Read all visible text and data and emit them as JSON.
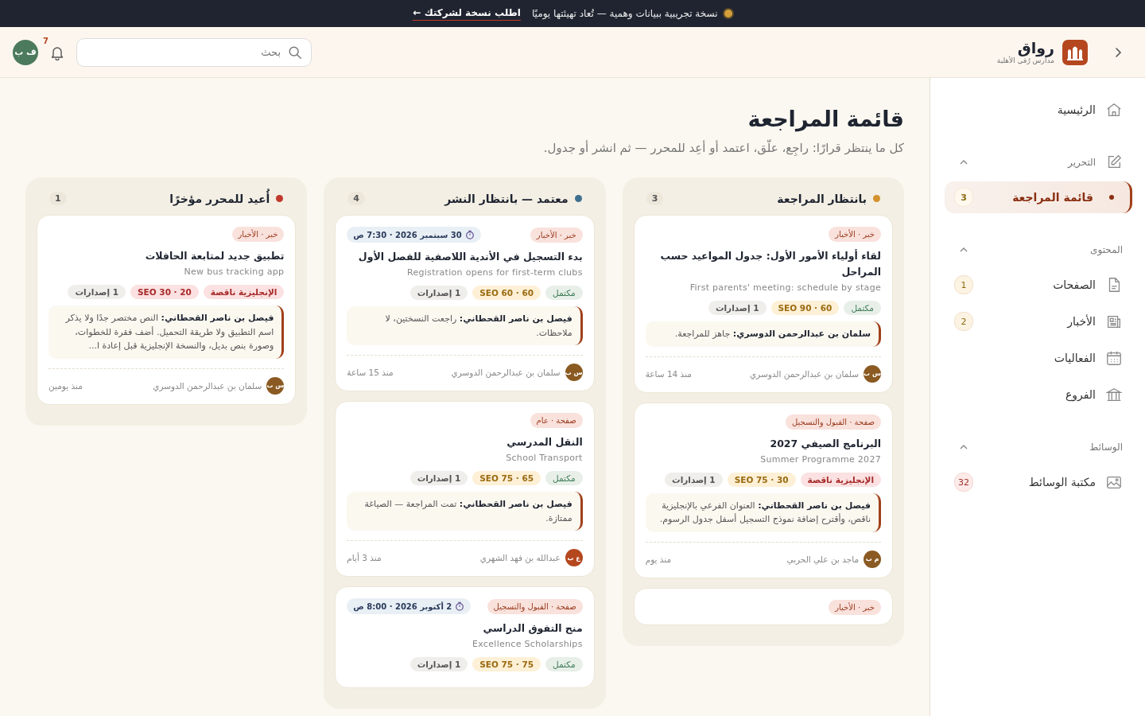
{
  "banner": {
    "text": "نسخة تجريبية ببيانات وهمية — تُعاد تهيئتها يوميًا",
    "link": "اطلب نسخة لشركتك ←"
  },
  "header": {
    "brand": "رواق",
    "org": "مدارس رُقي الأهلية",
    "search": {
      "placeholder": "بحث"
    },
    "notifications": "7",
    "user_initials": "ف ب"
  },
  "sidebar": {
    "items": [
      {
        "kind": "link",
        "label": "الرئيسية",
        "selected": false
      },
      {
        "kind": "section",
        "label": "التحرير",
        "expanded": true,
        "items": [
          {
            "label": "قائمة المراجعة",
            "count": "3",
            "selected": true
          }
        ]
      },
      {
        "kind": "section",
        "label": "المحتوى",
        "expanded": true,
        "items": [
          {
            "label": "الصفحات",
            "count": "1",
            "selected": false
          },
          {
            "label": "الأخبار",
            "count": "2",
            "selected": false
          },
          {
            "label": "الفعاليات",
            "selected": false
          },
          {
            "label": "الفروع",
            "selected": false
          }
        ]
      },
      {
        "kind": "section",
        "label": "الوسائط",
        "expanded": true,
        "items": [
          {
            "label": "مكتبة الوسائط",
            "count": "32",
            "selected": false
          }
        ]
      }
    ]
  },
  "page": {
    "title": "قائمة المراجعة",
    "subtitle": "كل ما ينتظر قرارًا: راجِع، علّق، اعتمد أو أعِد للمحرر — ثم انشر أو جدول."
  },
  "columns": [
    {
      "title": "بانتظار المراجعة",
      "count": "3",
      "color": "#d4912c",
      "cards": [
        {
          "tag": "خبر · الأخبار",
          "title": "لقاء أولياء الأمور الأول: جدول المواعيد حسب المراحل",
          "subtitle": "First parents' meeting: schedule by stage",
          "status": {
            "label": "مكتمل",
            "kind": "complete"
          },
          "seo": {
            "label": "SEO 90 · 60",
            "kind": "ok"
          },
          "versions": "1 إصدارات",
          "note": "**سلمان بن عبدالرحمن الدوسري:** جاهز للمراجعة.",
          "author": {
            "initials": "س ب",
            "name": "سلمان بن عبدالرحمن الدوسري",
            "color": "#8a5a22"
          },
          "time": "منذ 14 ساعة"
        },
        {
          "tag": "صفحة · القبول والتسجيل",
          "title": "البرنامج الصيفي 2027",
          "subtitle": "Summer Programme 2027",
          "status": {
            "label": "الإنجليزية ناقصة",
            "kind": "missing"
          },
          "seo": {
            "label": "SEO 75 · 30",
            "kind": "ok"
          },
          "versions": "1 إصدارات",
          "note": "**فيصل بن ناصر القحطاني:** العنوان الفرعي بالإنجليزية ناقص، وأقترح إضافة نموذج التسجيل أسفل جدول الرسوم.",
          "author": {
            "initials": "م ب",
            "name": "ماجد بن علي الحربي",
            "color": "#8a5a22"
          },
          "time": "منذ يوم"
        },
        {
          "tag": "خبر · الأخبار"
        }
      ]
    },
    {
      "title": "معتمد — بانتظار النشر",
      "count": "4",
      "color": "#3f6f8f",
      "cards": [
        {
          "tag": "خبر · الأخبار",
          "schedule": "30 سبتمبر 2026 · 7:30 ص",
          "title": "بدء التسجيل في الأندية اللاصفية للفصل الأول",
          "subtitle": "Registration opens for first-term clubs",
          "status": {
            "label": "مكتمل",
            "kind": "complete"
          },
          "seo": {
            "label": "SEO 60 · 60",
            "kind": "ok"
          },
          "versions": "1 إصدارات",
          "note": "**فيصل بن ناصر القحطاني:** راجعت النسختين، لا ملاحظات.",
          "author": {
            "initials": "س ب",
            "name": "سلمان بن عبدالرحمن الدوسري",
            "color": "#8a5a22"
          },
          "time": "منذ 15 ساعة"
        },
        {
          "tag": "صفحة · عام",
          "title": "النقل المدرسي",
          "subtitle": "School Transport",
          "status": {
            "label": "مكتمل",
            "kind": "complete"
          },
          "seo": {
            "label": "SEO 75 · 65",
            "kind": "ok"
          },
          "versions": "1 إصدارات",
          "note": "**فيصل بن ناصر القحطاني:** تمت المراجعة — الصياغة ممتازة.",
          "author": {
            "initials": "ع ب",
            "name": "عبدالله بن فهد الشهري",
            "color": "#b5471f"
          },
          "time": "منذ 3 أيام"
        },
        {
          "tag": "صفحة · القبول والتسجيل",
          "schedule": "2 أكتوبر 2026 · 8:00 ص",
          "title": "منح التفوق الدراسي",
          "subtitle": "Excellence Scholarships",
          "status": {
            "label": "مكتمل",
            "kind": "complete"
          },
          "seo": {
            "label": "SEO 75 · 75",
            "kind": "ok"
          },
          "versions": "1 إصدارات"
        }
      ]
    },
    {
      "title": "أُعيد للمحرر مؤخرًا",
      "count": "1",
      "color": "#c0392b",
      "cards": [
        {
          "tag": "خبر · الأخبار",
          "title": "تطبيق جديد لمتابعة الحافلات",
          "subtitle": "New bus tracking app",
          "status": {
            "label": "الإنجليزية ناقصة",
            "kind": "missing"
          },
          "seo": {
            "label": "SEO 30 · 20",
            "kind": "low"
          },
          "versions": "1 إصدارات",
          "note": "**فيصل بن ناصر القحطاني:** النص مختصر جدًا ولا يذكر اسم التطبيق ولا طريقة التحميل. أضف فقرة للخطوات، وصورة بنص بديل، والنسخة الإنجليزية قبل إعادة ا...",
          "author": {
            "initials": "س ب",
            "name": "سلمان بن عبدالرحمن الدوسري",
            "color": "#8a5a22"
          },
          "time": "منذ يومين"
        }
      ]
    }
  ]
}
